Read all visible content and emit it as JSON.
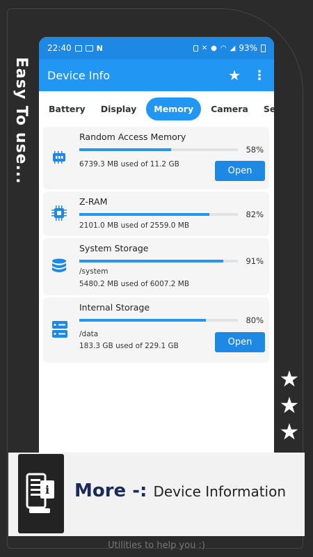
{
  "side_caption": "Easy To use...",
  "status": {
    "time": "22:40",
    "battery": "93%"
  },
  "appbar": {
    "title": "Device Info"
  },
  "tabs": [
    {
      "label": "Battery",
      "active": false
    },
    {
      "label": "Display",
      "active": false
    },
    {
      "label": "Memory",
      "active": true
    },
    {
      "label": "Camera",
      "active": false
    },
    {
      "label": "Sensors",
      "active": false
    }
  ],
  "cards": [
    {
      "name": "Random Access Memory",
      "percent_value": 58,
      "percent": "58%",
      "path": "",
      "usage": "6739.3 MB used of 11.2 GB",
      "button": "Open",
      "icon": "ram-chip-icon"
    },
    {
      "name": "Z-RAM",
      "percent_value": 82,
      "percent": "82%",
      "path": "",
      "usage": "2101.0 MB used of 2559.0 MB",
      "button": "",
      "icon": "cpu-chip-icon"
    },
    {
      "name": "System Storage",
      "percent_value": 91,
      "percent": "91%",
      "path": "/system",
      "usage": "5480.2 MB used of 6007.2 MB",
      "button": "",
      "icon": "database-icon"
    },
    {
      "name": "Internal Storage",
      "percent_value": 80,
      "percent": "80%",
      "path": "/data",
      "usage": "183.3 GB used of 229.1 GB",
      "button": "Open",
      "icon": "server-storage-icon"
    }
  ],
  "promo": {
    "more": "More -:",
    "title": "Device Information"
  },
  "footer": "Utilities to help you :)",
  "colors": {
    "accent": "#2196f3",
    "accent_dark": "#1e88e5",
    "background": "#2b2b2b"
  }
}
